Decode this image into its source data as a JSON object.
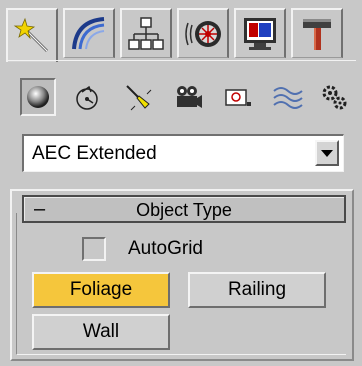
{
  "tabs": [
    {
      "icon": "create-wand-icon",
      "active": true
    },
    {
      "icon": "modify-arc-icon",
      "active": false
    },
    {
      "icon": "hierarchy-icon",
      "active": false
    },
    {
      "icon": "motion-wheel-icon",
      "active": false
    },
    {
      "icon": "display-monitor-icon",
      "active": false
    },
    {
      "icon": "utilities-hammer-icon",
      "active": false
    }
  ],
  "categories": [
    {
      "icon": "geometry-sphere-icon",
      "active": true
    },
    {
      "icon": "shapes-icon",
      "active": false
    },
    {
      "icon": "lights-icon",
      "active": false
    },
    {
      "icon": "cameras-icon",
      "active": false
    },
    {
      "icon": "helpers-icon",
      "active": false
    },
    {
      "icon": "space-warps-icon",
      "active": false
    },
    {
      "icon": "systems-gear-icon",
      "active": false
    }
  ],
  "dropdown": {
    "selected": "AEC Extended"
  },
  "rollout": {
    "collapse_symbol": "–",
    "title": "Object Type",
    "autogrid_label": "AutoGrid",
    "autogrid_checked": false,
    "buttons": {
      "foliage": "Foliage",
      "railing": "Railing",
      "wall": "Wall"
    },
    "active_button": "Foliage"
  },
  "colors": {
    "panel": "#c8c8c8",
    "active_button": "#f5c63c",
    "header_border": "#4a4a4a"
  }
}
